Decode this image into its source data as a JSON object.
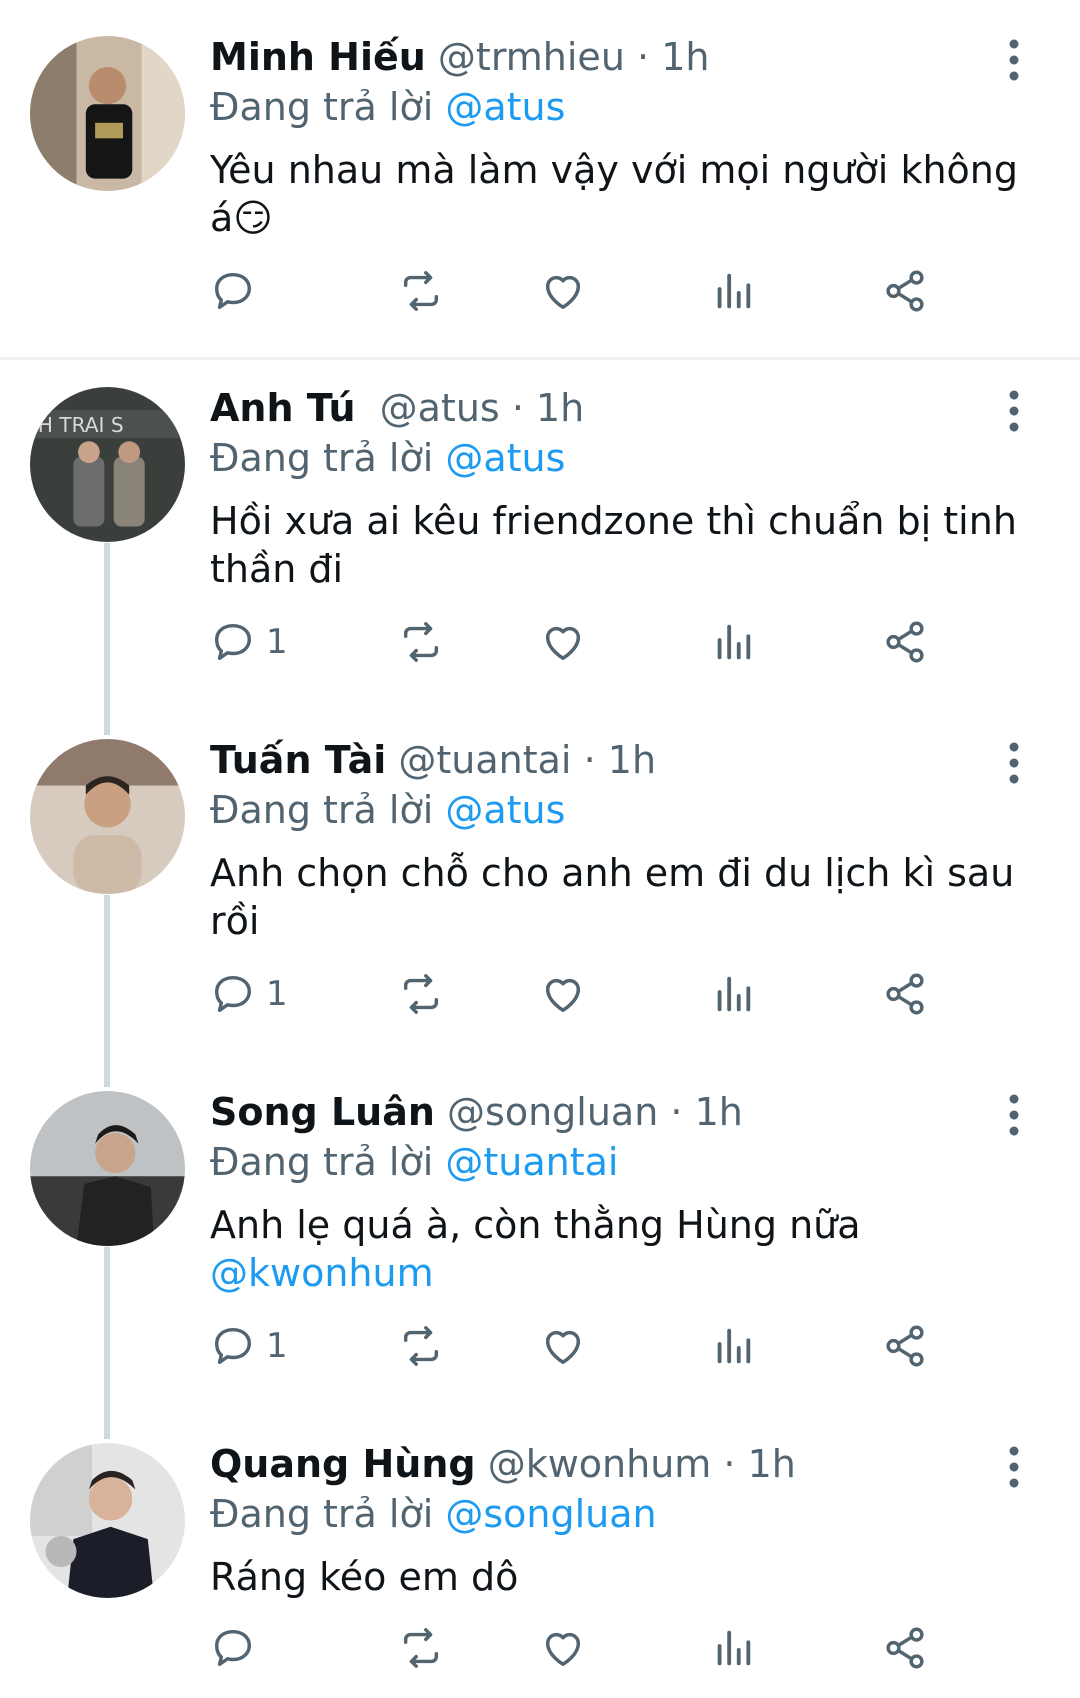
{
  "reply_prefix": "Đang trả lời",
  "icons": {
    "reply": "speech-bubble-icon",
    "retweet": "retweet-icon",
    "like": "heart-icon",
    "views": "bar-chart-icon",
    "share": "share-icon",
    "more": "vertical-dots-icon"
  },
  "colors": {
    "mention": "#1d9bf0",
    "muted": "#536471",
    "text": "#0f1419"
  },
  "tweets": [
    {
      "name": "Minh Hiếu",
      "handle": "@trmhieu",
      "dot": "·",
      "time": "1h",
      "reply_to": "@atus",
      "text": "Yêu nhau mà làm vậy với mọi người không á😏",
      "text_mention": "",
      "reply_count": ""
    },
    {
      "name": "Anh Tú",
      "handle": "@atus",
      "dot": "·",
      "time": "1h",
      "reply_to": "@atus",
      "text": "Hồi xưa ai kêu friendzone thì chuẩn bị tinh thần đi",
      "text_mention": "",
      "reply_count": "1"
    },
    {
      "name": "Tuấn Tài",
      "handle": "@tuantai",
      "dot": "·",
      "time": "1h",
      "reply_to": "@atus",
      "text": "Anh chọn chỗ cho anh em đi du lịch kì sau rồi",
      "text_mention": "",
      "reply_count": "1"
    },
    {
      "name": "Song Luân",
      "handle": "@songluan",
      "dot": "·",
      "time": "1h",
      "reply_to": "@tuantai",
      "text": "Anh lẹ quá à, còn thằng Hùng nữa",
      "text_mention": "@kwonhum",
      "reply_count": "1"
    },
    {
      "name": "Quang Hùng",
      "handle": "@kwonhum",
      "dot": "·",
      "time": "1h",
      "reply_to": "@songluan",
      "text": "Ráng kéo em dô",
      "text_mention": "",
      "reply_count": ""
    }
  ]
}
